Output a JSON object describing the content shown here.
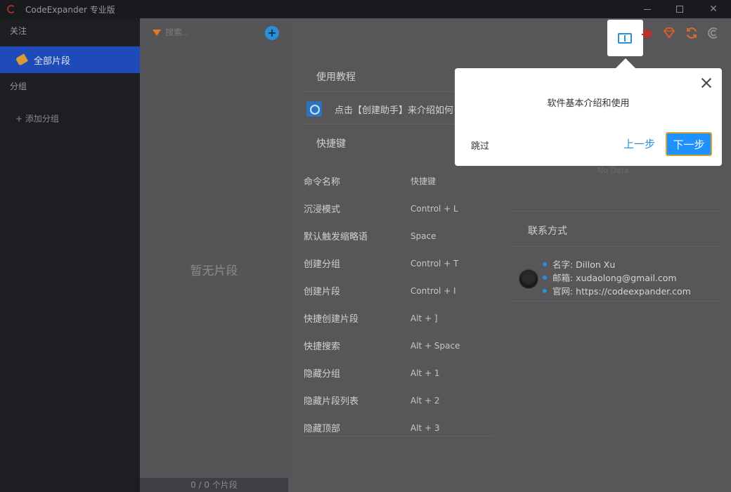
{
  "window": {
    "title": "CodeExpander 专业版"
  },
  "sidebar": {
    "follow_label": "关注",
    "all_snippets_label": "全部片段",
    "group_label": "分组",
    "add_group_label": "+ 添加分组"
  },
  "snippet_list": {
    "search_placeholder": "搜索...",
    "add_button_label": "+",
    "empty_text": "暂无片段",
    "footer": "0 / 0 个片段"
  },
  "toolbar_icons": [
    "book-icon",
    "bug-icon",
    "gem-icon",
    "sync-icon",
    "copyright-icon"
  ],
  "main": {
    "tutorial_title": "使用教程",
    "tutorial_item": "点击【创建助手】来介绍如何",
    "hotkeys_title": "快捷键",
    "hotkey_header": {
      "name": "命令名称",
      "key": "快捷键"
    },
    "hotkeys": [
      {
        "name": "沉浸模式",
        "key": "Control + L"
      },
      {
        "name": "默认触发缩略语",
        "key": "Space"
      },
      {
        "name": "创建分组",
        "key": "Control + T"
      },
      {
        "name": "创建片段",
        "key": "Control + I"
      },
      {
        "name": "快捷创建片段",
        "key": "Alt + ]"
      },
      {
        "name": "快捷搜索",
        "key": "Alt + Space"
      },
      {
        "name": "隐藏分组",
        "key": "Alt + 1"
      },
      {
        "name": "隐藏片段列表",
        "key": "Alt + 2"
      },
      {
        "name": "隐藏顶部",
        "key": "Alt + 3"
      }
    ],
    "no_data": "No Data",
    "contact_title": "联系方式",
    "contact": {
      "name": "名字: Dillon Xu",
      "email": "邮箱: xudaolong@gmail.com",
      "website": "官网: https://codeexpander.com"
    }
  },
  "tour_popup": {
    "text": "软件基本介绍和使用",
    "skip": "跳过",
    "prev": "上一步",
    "next": "下一步"
  },
  "colors": {
    "accent": "#1e90ff",
    "sidebar_active": "#1f4bb8",
    "warning": "#e27a1e"
  }
}
